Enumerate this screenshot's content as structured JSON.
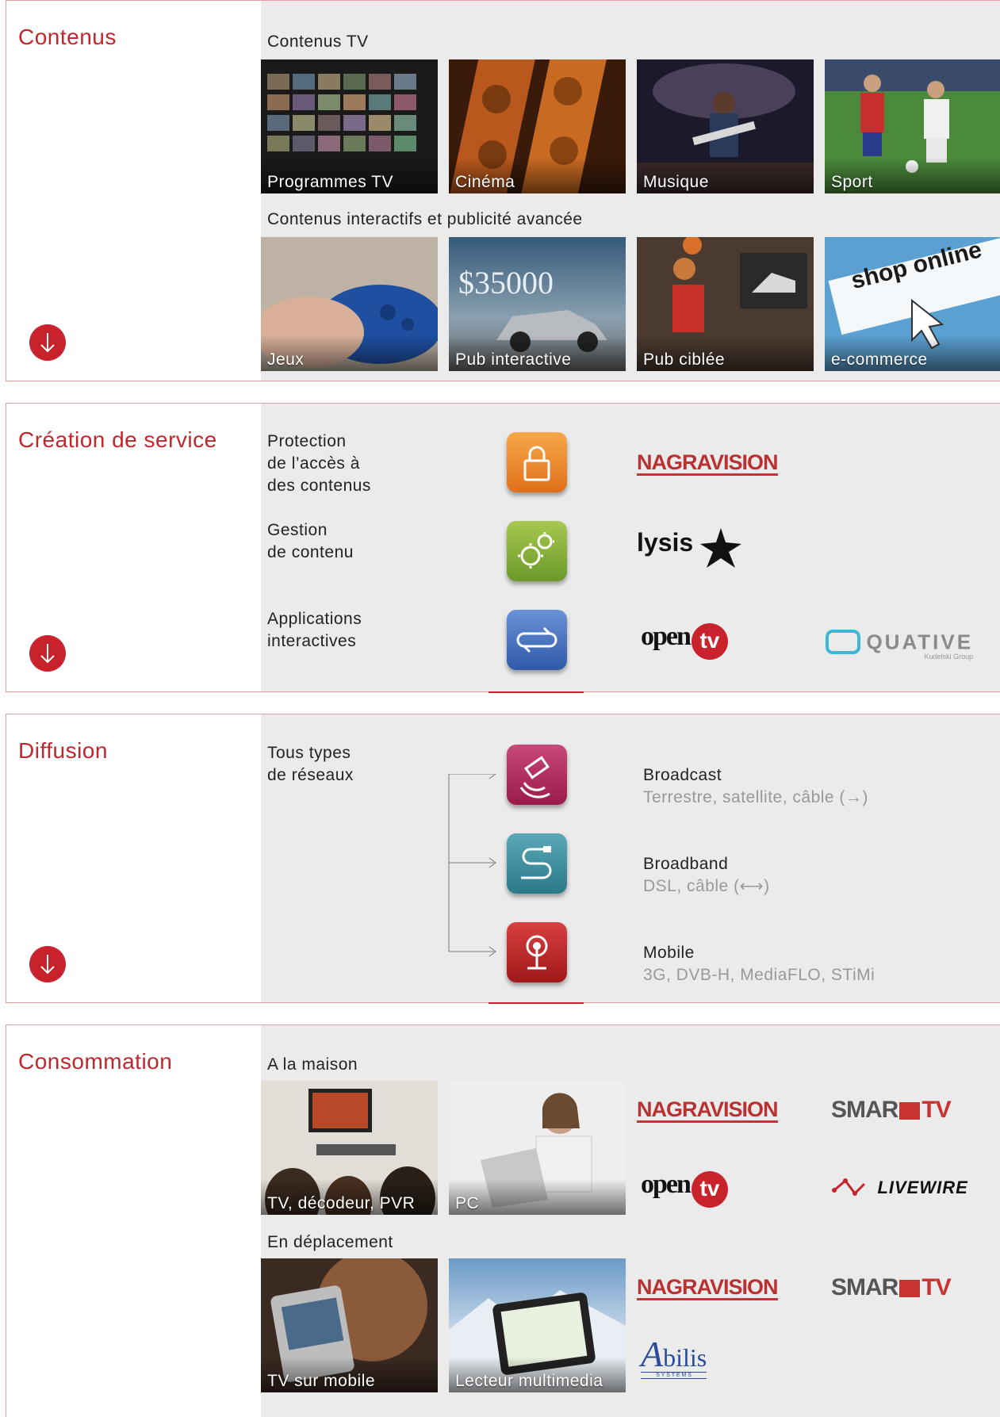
{
  "sections": {
    "contenus": {
      "title": "Contenus",
      "tv_label": "Contenus TV",
      "tv_items": [
        "Programmes TV",
        "Cinéma",
        "Musique",
        "Sport"
      ],
      "interactive_label": "Contenus interactifs et publicité avancée",
      "interactive_items": [
        "Jeux",
        "Pub interactive",
        "Pub ciblée",
        "e-commerce"
      ],
      "pub_price": "$35000",
      "shop_text": "shop online"
    },
    "creation": {
      "title": "Création de service",
      "rows": [
        {
          "label_lines": [
            "Protection",
            "de l’accès à",
            "des contenus"
          ],
          "icon": "lock-icon"
        },
        {
          "label_lines": [
            "Gestion",
            "de contenu"
          ],
          "icon": "gears-icon"
        },
        {
          "label_lines": [
            "Applications",
            "interactives"
          ],
          "icon": "arrows-swap-icon"
        }
      ],
      "logos": {
        "nagra": "NAGRAVISION",
        "lysis": "lysis",
        "opentv": "open",
        "opentv_tv": "tv",
        "quative": "QUATIVE",
        "quative_sub": "Kudelski Group"
      }
    },
    "diffusion": {
      "title": "Diffusion",
      "label_lines": [
        "Tous types",
        "de réseaux"
      ],
      "networks": [
        {
          "name": "Broadcast",
          "detail": "Terrestre, satellite, câble (→)",
          "icon": "satellite-icon"
        },
        {
          "name": "Broadband",
          "detail": "DSL, câble (⟷)",
          "icon": "cable-icon"
        },
        {
          "name": "Mobile",
          "detail": "3G, DVB-H, MediaFLO, STiMi",
          "icon": "antenna-icon"
        }
      ]
    },
    "consommation": {
      "title": "Consommation",
      "home_label": "A la maison",
      "home_items": [
        "TV, décodeur, PVR",
        "PC"
      ],
      "mobile_label": "En déplacement",
      "mobile_items": [
        "TV sur mobile",
        "Lecteur multimedia"
      ],
      "logos": {
        "nagra": "NAGRAVISION",
        "smardtv_a": "SMAR",
        "smardtv_b": "TV",
        "opentv": "open",
        "opentv_tv": "tv",
        "livewire": "LIVEWIRE",
        "abilis": "bilis",
        "abilis_a": "A",
        "abilis_sub": "S Y S T E M S"
      }
    }
  },
  "colors": {
    "accent": "#c0272d",
    "panel_bg": "#ebebeb",
    "subtext": "#999999"
  }
}
